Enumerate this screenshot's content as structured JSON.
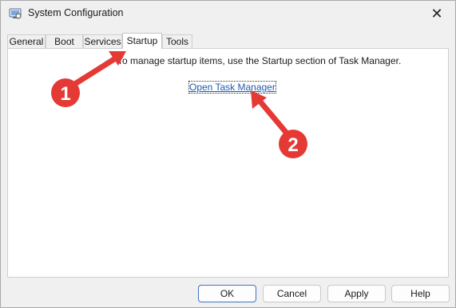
{
  "window": {
    "title": "System Configuration",
    "close_symbol": "✕"
  },
  "tabs": [
    {
      "label": "General"
    },
    {
      "label": "Boot"
    },
    {
      "label": "Services"
    },
    {
      "label": "Startup",
      "active": true
    },
    {
      "label": "Tools"
    }
  ],
  "startup_panel": {
    "instruction": "To manage startup items, use the Startup section of Task Manager.",
    "link_label": "Open Task Manager"
  },
  "footer": {
    "ok_label": "OK",
    "cancel_label": "Cancel",
    "apply_label": "Apply",
    "help_label": "Help"
  },
  "annotations": {
    "badge_1": "1",
    "badge_2": "2",
    "color": "#e53935"
  },
  "colors": {
    "window_bg": "#f0f0f0",
    "link": "#1f5bb0",
    "primary_border": "#3d74c7"
  }
}
